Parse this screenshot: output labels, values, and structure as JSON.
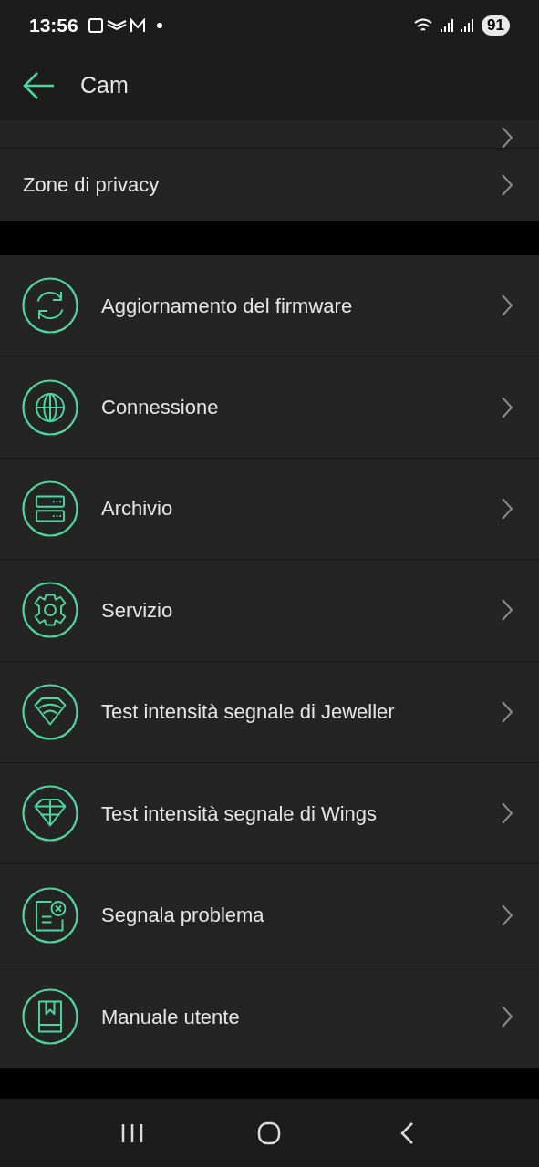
{
  "status_bar": {
    "time": "13:56",
    "battery": "91"
  },
  "header": {
    "title": "Cam"
  },
  "top_rows": [
    {
      "label": "Zone di privacy"
    }
  ],
  "menu": [
    {
      "kind": "sync",
      "label": "Aggiornamento del firmware"
    },
    {
      "kind": "globe",
      "label": "Connessione"
    },
    {
      "kind": "storage",
      "label": "Archivio"
    },
    {
      "kind": "gear",
      "label": "Servizio"
    },
    {
      "kind": "signal",
      "label": "Test intensità segnale di Jeweller"
    },
    {
      "kind": "diamond",
      "label": "Test intensità segnale di Wings"
    },
    {
      "kind": "report",
      "label": "Segnala problema"
    },
    {
      "kind": "book",
      "label": "Manuale utente"
    }
  ]
}
